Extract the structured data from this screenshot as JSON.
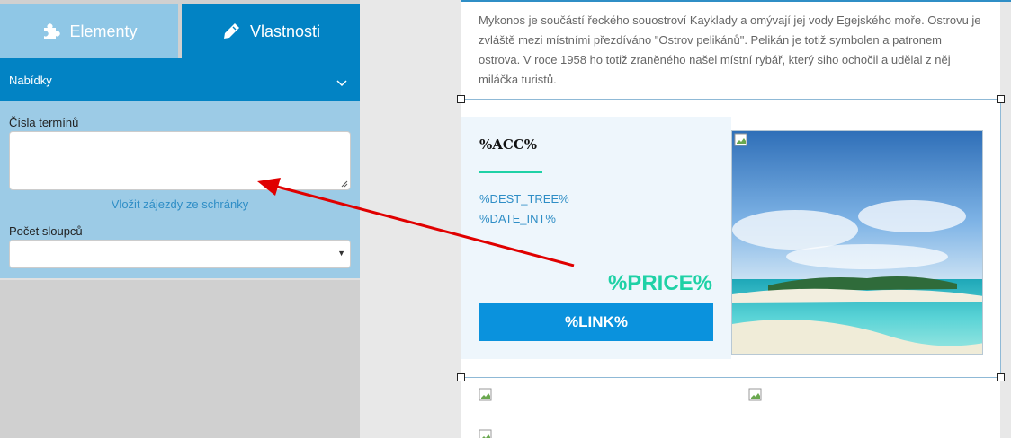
{
  "tabs": {
    "elements": "Elementy",
    "properties": "Vlastnosti"
  },
  "section": {
    "title": "Nabídky"
  },
  "form": {
    "terms_label": "Čísla termínů",
    "terms_value": "",
    "paste_link": "Vložit zájezdy ze schránky",
    "columns_label": "Počet sloupců",
    "columns_value": ""
  },
  "content": {
    "intro": "Mykonos je součástí řeckého souostroví Kayklady a omývají jej vody Egejského moře. Ostrovu je zvláště mezi místními přezdíváno \"Ostrov pelikánů\". Pelikán je totiž symbolen a patronem ostrova. V roce 1958 ho totiž zraněného našel místní rybář, který siho ochočil a udělal z něj miláčka turistů.",
    "acc": "%ACC%",
    "dest_tree": "%DEST_TREE%",
    "date_int": "%DATE_INT%",
    "price": "%PRICE%",
    "link": "%LINK%"
  },
  "colors": {
    "panel_blue": "#0283c4",
    "tab_light_blue": "#8fc7e6",
    "accent_green": "#1fd1a6",
    "button_blue": "#0a92dd",
    "annotation_arrow": "#e00000"
  },
  "icons": {
    "elements_tab": "puzzle-icon",
    "properties_tab": "pencil-icon",
    "section_toggle": "chevron-down-icon"
  }
}
